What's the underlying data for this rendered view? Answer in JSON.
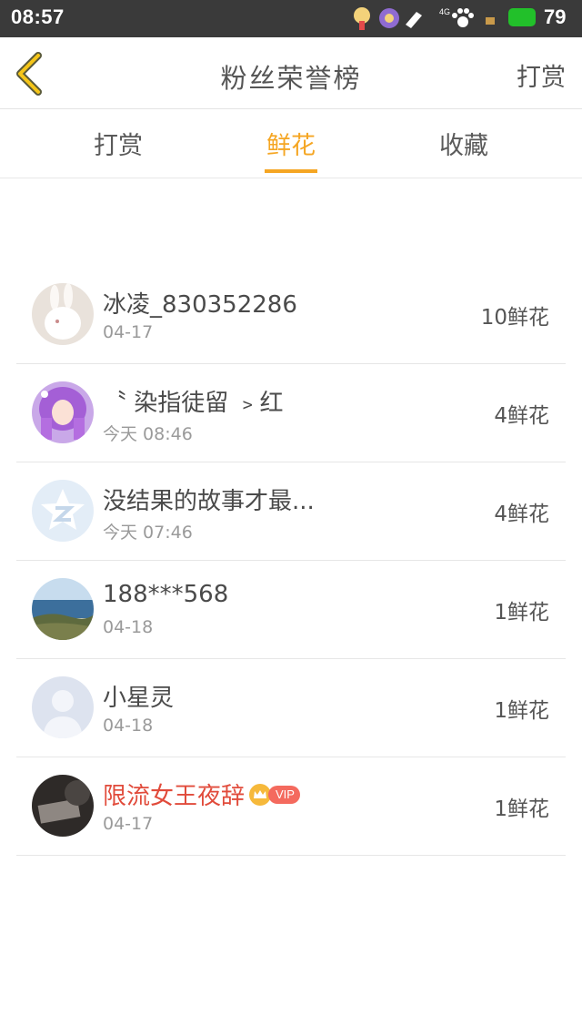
{
  "status_bar": {
    "time": "08:57",
    "network": "4G",
    "battery": "79"
  },
  "nav": {
    "title": "粉丝荣誉榜",
    "action": "打赏"
  },
  "tabs": [
    {
      "label": "打赏",
      "active": false
    },
    {
      "label": "鲜花",
      "active": true
    },
    {
      "label": "收藏",
      "active": false
    }
  ],
  "fans": [
    {
      "name": "冰凌_830352286",
      "date": "04-17",
      "count": "10鲜花",
      "avatar": "rabbit-avatar"
    },
    {
      "name": "〝 染指徒留 ﹥红",
      "date": "今天 08:46",
      "count": "4鲜花",
      "avatar": "anime-girl-avatar"
    },
    {
      "name": "没结果的故事才最...",
      "date": "今天 07:46",
      "count": "4鲜花",
      "avatar": "qq-default-avatar"
    },
    {
      "name": "188***568",
      "date": "04-18",
      "count": "1鲜花",
      "avatar": "seaside-avatar"
    },
    {
      "name": "小星灵",
      "date": "04-18",
      "count": "1鲜花",
      "avatar": "default-person-avatar"
    },
    {
      "name": "限流女王夜辞",
      "date": "04-17",
      "count": "1鲜花",
      "avatar": "dark-photo-avatar",
      "vip": "VIP"
    }
  ],
  "colors": {
    "accent": "#f5a623",
    "vip_name": "#e14b3b",
    "status_bar": "#3a3a3a"
  }
}
